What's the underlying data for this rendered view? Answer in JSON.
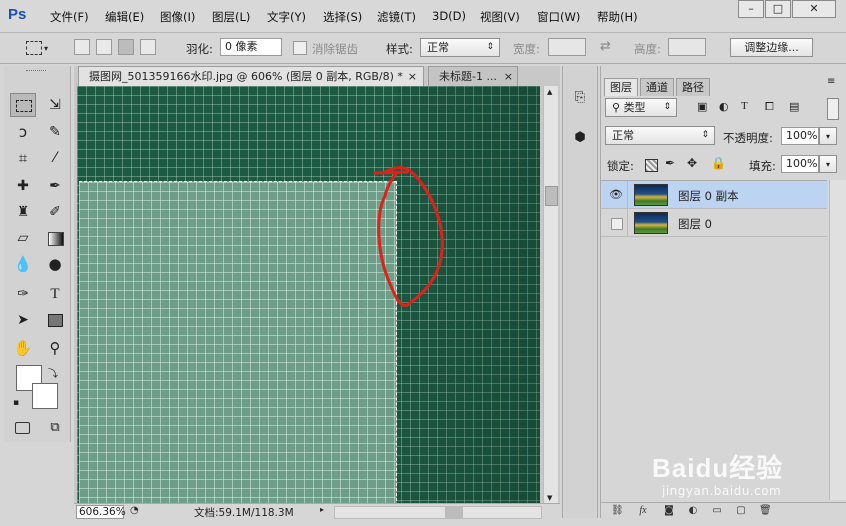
{
  "app": {
    "logo": "Ps"
  },
  "menus": [
    "文件(F)",
    "编辑(E)",
    "图像(I)",
    "图层(L)",
    "文字(Y)",
    "选择(S)",
    "滤镜(T)",
    "3D(D)",
    "视图(V)",
    "窗口(W)",
    "帮助(H)"
  ],
  "window_controls": {
    "minimize": "–",
    "maximize": "□",
    "close": "✕"
  },
  "options": {
    "feather_label": "羽化:",
    "feather_value": "0 像素",
    "antialias_label": "消除锯齿",
    "style_label": "样式:",
    "style_value": "正常",
    "width_label": "宽度:",
    "height_label": "高度:",
    "refine_edge_button": "调整边缘..."
  },
  "tabs": [
    {
      "label": "摄图网_501359166水印.jpg @ 606% (图层 0 副本, RGB/8) *",
      "close": "×"
    },
    {
      "label": "未标题-1 ...",
      "close": "×"
    }
  ],
  "status": {
    "zoom": "606.36%",
    "doc_info": "文档:59.1M/118.3M"
  },
  "panel": {
    "tabs": [
      "图层",
      "通道",
      "路径"
    ],
    "filter_kind": "类型",
    "blend_mode": "正常",
    "opacity_label": "不透明度:",
    "opacity_value": "100%",
    "lock_label": "锁定:",
    "fill_label": "填充:",
    "fill_value": "100%",
    "layers": [
      {
        "name": "图层 0 副本",
        "visible": true,
        "selected": true
      },
      {
        "name": "图层 0",
        "visible": false,
        "selected": false
      }
    ],
    "bottom_icons": [
      "link-icon",
      "fx-icon",
      "mask-icon",
      "adjustment-icon",
      "group-icon",
      "new-layer-icon",
      "trash-icon"
    ]
  },
  "watermark": {
    "brand": "Baidu经验",
    "url": "jingyan.baidu.com"
  },
  "colors": {
    "canvas_dark": "#1d5a44",
    "canvas_light": "#6e9e8a",
    "annotation": "#e0201a",
    "selected_layer": "#bcd3f2"
  }
}
